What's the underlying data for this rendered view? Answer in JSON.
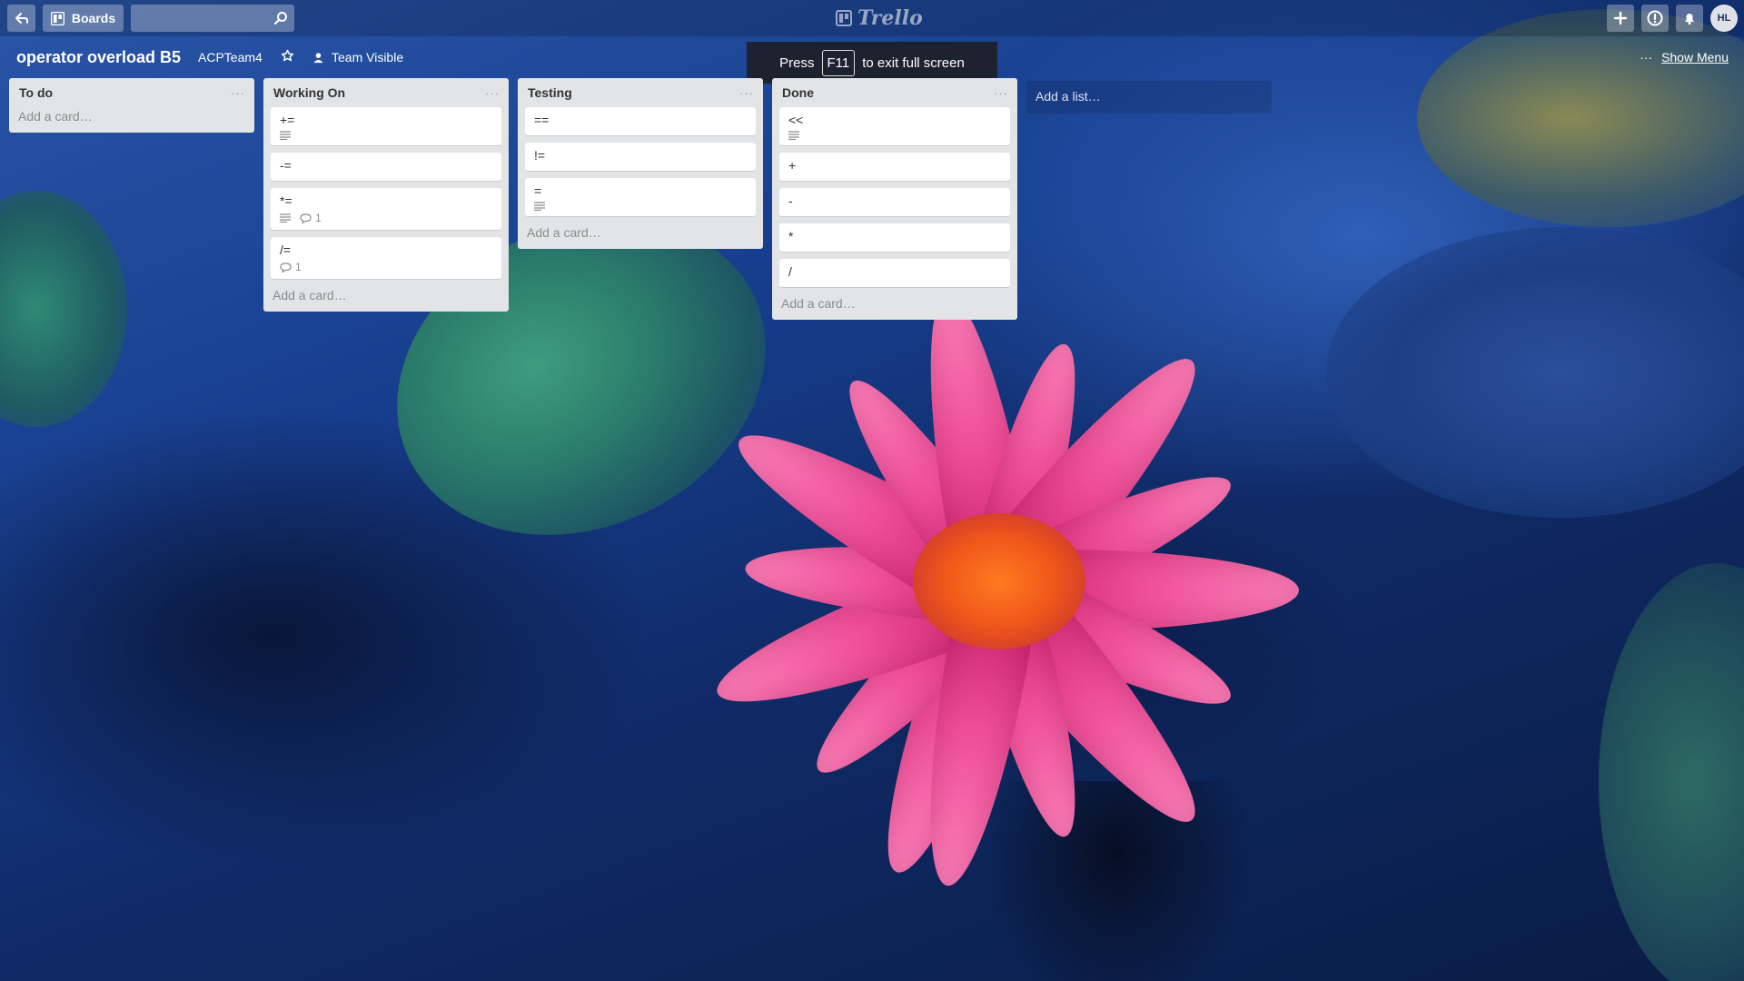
{
  "header": {
    "boards_label": "Boards",
    "logo_text": "Trello",
    "avatar_initials": "HL"
  },
  "board": {
    "title": "operator overload B5",
    "team": "ACPTeam4",
    "visibility": "Team Visible",
    "show_menu": "Show Menu"
  },
  "fullscreen_notice": {
    "pre": "Press",
    "key": "F11",
    "post": "to exit full screen"
  },
  "lists": [
    {
      "title": "To do",
      "add_card": "Add a card…",
      "cards": []
    },
    {
      "title": "Working On",
      "add_card": "Add a card…",
      "cards": [
        {
          "title": "+=",
          "description": true,
          "comments": null
        },
        {
          "title": "-=",
          "description": false,
          "comments": null
        },
        {
          "title": "*=",
          "description": true,
          "comments": "1"
        },
        {
          "title": "/=",
          "description": false,
          "comments": "1"
        }
      ]
    },
    {
      "title": "Testing",
      "add_card": "Add a card…",
      "cards": [
        {
          "title": "==",
          "description": false,
          "comments": null
        },
        {
          "title": "!=",
          "description": false,
          "comments": null
        },
        {
          "title": "=",
          "description": true,
          "comments": null
        }
      ]
    },
    {
      "title": "Done",
      "add_card": "Add a card…",
      "cards": [
        {
          "title": "<<",
          "description": true,
          "comments": null
        },
        {
          "title": "+",
          "description": false,
          "comments": null
        },
        {
          "title": "-",
          "description": false,
          "comments": null
        },
        {
          "title": "*",
          "description": false,
          "comments": null
        },
        {
          "title": "/",
          "description": false,
          "comments": null
        }
      ]
    }
  ],
  "add_list": "Add a list…",
  "icons": {
    "back": "back-arrow-icon",
    "boards": "boards-icon",
    "search": "search-icon",
    "add": "plus-icon",
    "info": "info-icon",
    "notifications": "bell-icon",
    "star": "star-icon",
    "visibility": "team-icon",
    "more": "ellipsis-icon",
    "description": "description-icon",
    "comment": "comment-icon"
  },
  "colors": {
    "list_bg": "#e2e4e6",
    "card_bg": "#ffffff",
    "header_btn": "rgba(255,255,255,0.3)"
  }
}
